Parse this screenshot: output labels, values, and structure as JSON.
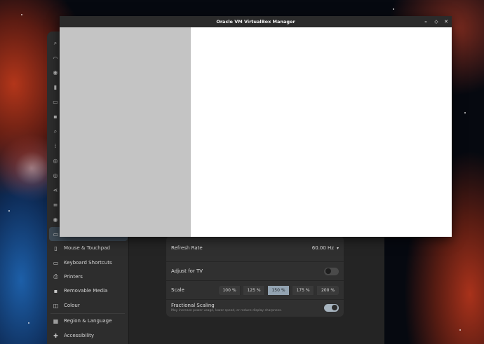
{
  "vbox": {
    "title": "Oracle VM VirtualBox Manager",
    "controls": {
      "minimize": "–",
      "maximize": "◇",
      "close": "✕"
    }
  },
  "settings": {
    "sidebar": {
      "hidden_icons": [
        "search-icon",
        "wifi-icon",
        "network-icon",
        "bluetooth-icon",
        "display-icon",
        "sound-icon",
        "search-icon",
        "apps-icon",
        "notifications-icon",
        "privacy-icon",
        "sharing-icon",
        "sliders-icon",
        "power-icon",
        "displays-icon"
      ],
      "items": [
        {
          "label": "Mouse & Touchpad",
          "icon": "mouse-icon",
          "glyph": "▯"
        },
        {
          "label": "Keyboard Shortcuts",
          "icon": "keyboard-icon",
          "glyph": "▭"
        },
        {
          "label": "Printers",
          "icon": "printer-icon",
          "glyph": "⎙"
        },
        {
          "label": "Removable Media",
          "icon": "media-icon",
          "glyph": "▪"
        },
        {
          "label": "Colour",
          "icon": "colour-icon",
          "glyph": "◫"
        },
        {
          "label": "Region & Language",
          "icon": "region-icon",
          "glyph": "▦"
        },
        {
          "label": "Accessibility",
          "icon": "accessibility-icon",
          "glyph": "✚"
        }
      ]
    },
    "display": {
      "refresh_rate_label": "Refresh Rate",
      "refresh_rate_value": "60.00 Hz",
      "adjust_tv_label": "Adjust for TV",
      "adjust_tv_on": false,
      "scale_label": "Scale",
      "scale_options": [
        "100 %",
        "125 %",
        "150 %",
        "175 %",
        "200 %"
      ],
      "scale_selected": "150 %",
      "fractional_label": "Fractional Scaling",
      "fractional_sub": "May increase power usage, lower speed, or reduce display sharpness.",
      "fractional_on": true
    }
  }
}
